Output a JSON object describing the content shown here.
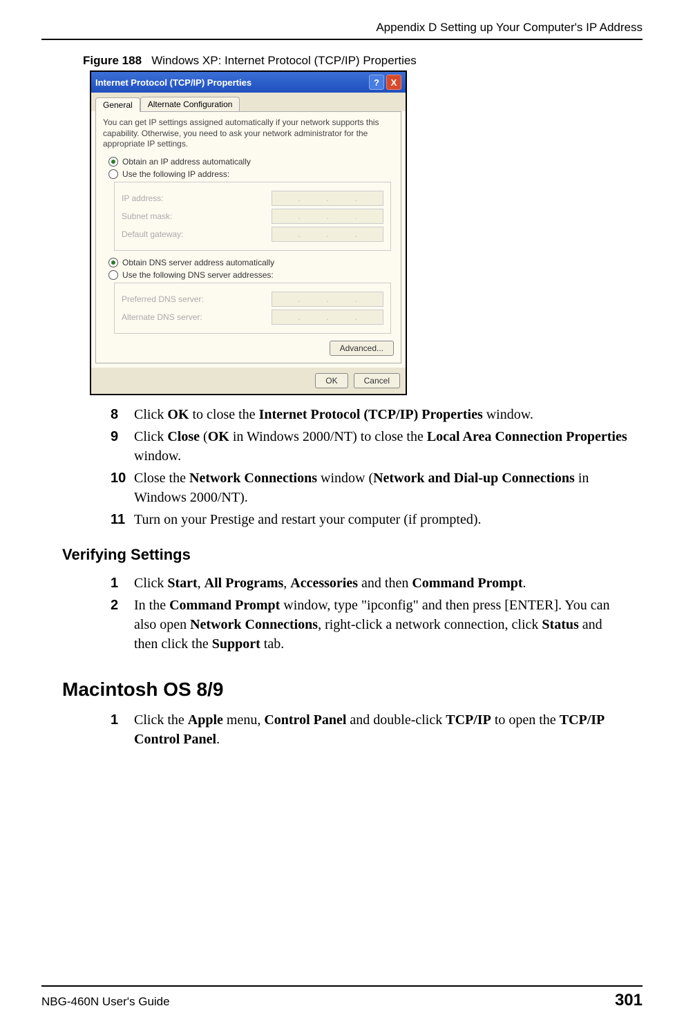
{
  "header": {
    "appendix": "Appendix D Setting up Your Computer's IP Address"
  },
  "figure": {
    "label": "Figure 188",
    "caption": "Windows XP: Internet Protocol (TCP/IP) Properties"
  },
  "dialog": {
    "title": "Internet Protocol (TCP/IP) Properties",
    "help": "?",
    "close": "X",
    "tabs": {
      "general": "General",
      "alt": "Alternate Configuration"
    },
    "desc": "You can get IP settings assigned automatically if your network supports this capability. Otherwise, you need to ask your network administrator for the appropriate IP settings.",
    "radio": {
      "obtain_ip": "Obtain an IP address automatically",
      "use_ip": "Use the following IP address:",
      "obtain_dns": "Obtain DNS server address automatically",
      "use_dns": "Use the following DNS server addresses:"
    },
    "fields": {
      "ip": "IP address:",
      "subnet": "Subnet mask:",
      "gateway": "Default gateway:",
      "pref_dns": "Preferred DNS server:",
      "alt_dns": "Alternate DNS server:"
    },
    "buttons": {
      "advanced": "Advanced...",
      "ok": "OK",
      "cancel": "Cancel"
    }
  },
  "steps1": [
    {
      "n": "8",
      "parts": [
        "Click ",
        "OK",
        " to close the ",
        "Internet Protocol (TCP/IP) Properties",
        " window."
      ]
    },
    {
      "n": "9",
      "parts": [
        "Click ",
        "Close",
        " (",
        "OK",
        " in Windows 2000/NT) to close the ",
        "Local Area Connection Properties",
        " window."
      ]
    },
    {
      "n": "10",
      "parts": [
        "Close the ",
        "Network Connections",
        " window (",
        "Network and Dial-up Connections",
        " in Windows 2000/NT)."
      ]
    },
    {
      "n": "11",
      "parts": [
        "Turn on your Prestige and restart your computer (if prompted)."
      ]
    }
  ],
  "h_verify": "Verifying Settings",
  "steps2": [
    {
      "n": "1",
      "parts": [
        "Click ",
        "Start",
        ", ",
        "All Programs",
        ", ",
        "Accessories",
        " and then ",
        "Command Prompt",
        "."
      ]
    },
    {
      "n": "2",
      "parts": [
        "In the ",
        "Command Prompt",
        " window, type \"ipconfig\" and then press [ENTER]. You can also open ",
        "Network Connections",
        ", right-click a network connection, click ",
        "Status",
        " and then click the ",
        "Support",
        " tab."
      ]
    }
  ],
  "h_mac": "Macintosh OS 8/9",
  "steps3": [
    {
      "n": "1",
      "parts": [
        "Click the ",
        "Apple",
        " menu, ",
        "Control Panel",
        " and double-click ",
        "TCP/IP",
        " to open the ",
        "TCP/IP Control Panel",
        "."
      ]
    }
  ],
  "footer": {
    "guide": "NBG-460N User's Guide",
    "page": "301"
  }
}
